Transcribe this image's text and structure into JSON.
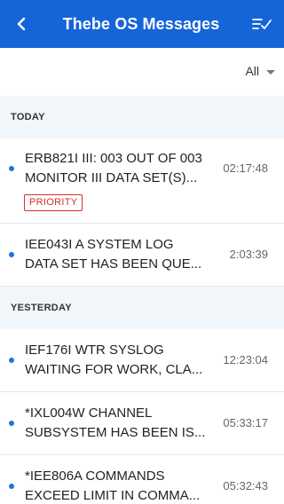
{
  "header": {
    "title": "Thebe OS Messages",
    "back_icon": "chevron-left-icon",
    "action_icon": "mark-all-read-icon",
    "background": "#1565d8"
  },
  "filter": {
    "selected": "All"
  },
  "sections": [
    {
      "title": "TODAY",
      "messages": [
        {
          "line1": "ERB821I III: 003 OUT OF 003",
          "line2": "MONITOR III DATA SET(S)...",
          "time": "02:17:48",
          "unread": true,
          "badge": "PRIORITY"
        },
        {
          "line1": "IEE043I A SYSTEM LOG",
          "line2": "DATA SET HAS BEEN QUE...",
          "time": "2:03:39",
          "unread": true
        }
      ]
    },
    {
      "title": "YESTERDAY",
      "messages": [
        {
          "line1": "IEF176I WTR SYSLOG",
          "line2": "WAITING FOR WORK, CLA...",
          "time": "12:23:04",
          "unread": true
        },
        {
          "line1": "*IXL004W CHANNEL",
          "line2": "SUBSYSTEM HAS BEEN IS...",
          "time": "05:33:17",
          "unread": true
        },
        {
          "line1": "*IEE806A COMMANDS",
          "line2": "EXCEED LIMIT IN COMMA...",
          "time": "05:32:43",
          "unread": true
        }
      ]
    }
  ],
  "colors": {
    "accent": "#1565d8",
    "unread_dot": "#1a73e8",
    "priority": "#d32f2f",
    "section_bg": "#f1f6fb"
  }
}
